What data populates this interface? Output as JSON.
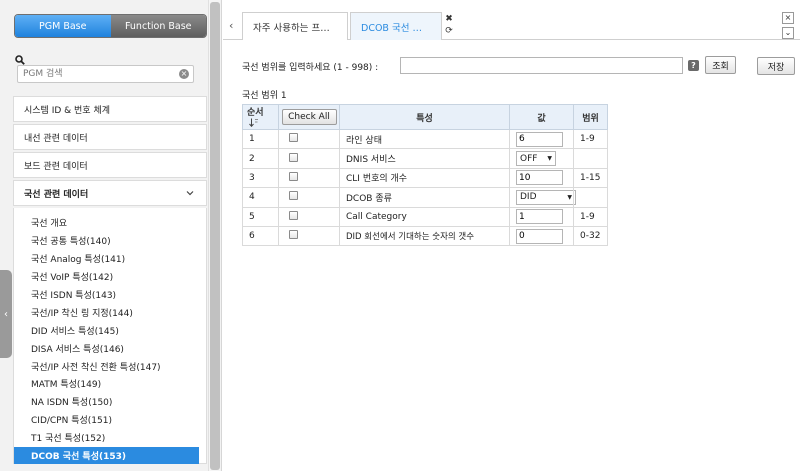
{
  "sidebar": {
    "mode_tabs": [
      "PGM Base",
      "Function Base"
    ],
    "search": {
      "placeholder": "PGM 검색",
      "value": ""
    },
    "menu": [
      "시스템 ID & 번호 체계",
      "내선 관련 데이터",
      "보드 관련 데이터"
    ],
    "expanded_group": {
      "label": "국선 관련 데이터",
      "items": [
        "국선 개요",
        "국선 공통 특성(140)",
        "국선 Analog 특성(141)",
        "국선 VoIP 특성(142)",
        "국선 ISDN 특성(143)",
        "국선/IP 착신 링 지정(144)",
        "DID 서비스 특성(145)",
        "DISA 서비스 특성(146)",
        "국선/IP 사전 착신 전환 특성(147)",
        "MATM 특성(149)",
        "NA ISDN 특성(150)",
        "CID/CPN 특성(151)",
        "T1 국선 특성(152)",
        "DCOB 국선 특성(153)"
      ],
      "selected_index": 13
    }
  },
  "tabs": {
    "items": [
      "자주 사용하는 프…",
      "DCOB 국선 …"
    ],
    "active_index": 1
  },
  "form": {
    "range_label": "국선 범위를 입력하세요 (1 - 998) :",
    "range_value": "",
    "help": "?",
    "query_button": "조회",
    "save_button": "저장",
    "range_caption": "국선 범위 1"
  },
  "table": {
    "headers": {
      "seq": "순서",
      "check_all": "Check All",
      "property": "특성",
      "value": "값",
      "range": "범위"
    },
    "rows": [
      {
        "seq": "1",
        "property": "라인 상태",
        "value": "6",
        "value_type": "input",
        "range": "1-9"
      },
      {
        "seq": "2",
        "property": "DNIS 서비스",
        "value": "OFF",
        "value_type": "select-sm",
        "range": ""
      },
      {
        "seq": "3",
        "property": "CLI 번호의 개수",
        "value": "10",
        "value_type": "input",
        "range": "1-15"
      },
      {
        "seq": "4",
        "property": "DCOB 종류",
        "value": "DID",
        "value_type": "select-lg",
        "range": ""
      },
      {
        "seq": "5",
        "property": "Call Category",
        "value": "1",
        "value_type": "input",
        "range": "1-9"
      },
      {
        "seq": "6",
        "property": "DID 회선에서 기대하는 숫자의 갯수",
        "value": "0",
        "value_type": "input",
        "range": "0-32"
      }
    ]
  },
  "icons": {
    "search": "search-icon",
    "clear": "clear-icon",
    "chevron": "chevron-down-icon",
    "sort": "sort-icon",
    "help": "help-icon",
    "close": "close-icon",
    "refresh": "refresh-icon"
  },
  "colors": {
    "accent": "#2b8be0",
    "header_bg": "#e8f0f9"
  }
}
